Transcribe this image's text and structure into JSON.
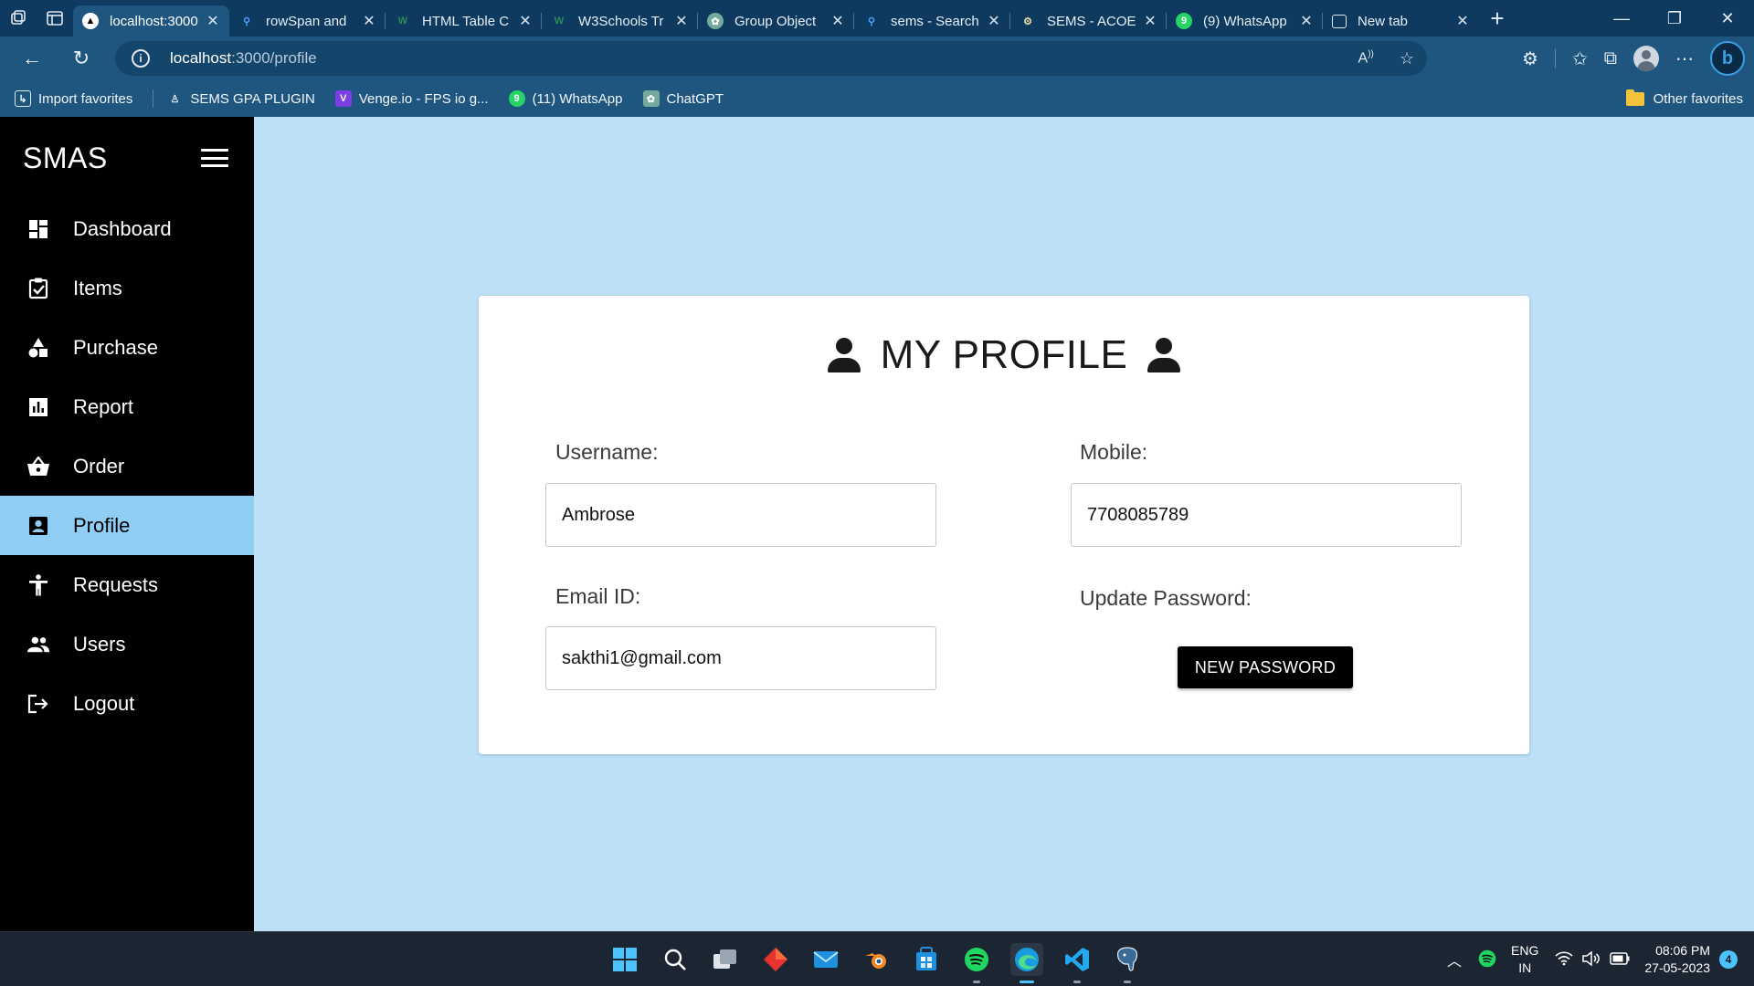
{
  "browser": {
    "tabs": [
      {
        "title": "localhost:3000",
        "icon": "react-triangle-icon",
        "active": true
      },
      {
        "title": "rowSpan and",
        "icon": "search-icon"
      },
      {
        "title": "HTML Table C",
        "icon": "w3schools-icon"
      },
      {
        "title": "W3Schools Tr",
        "icon": "w3schools-icon"
      },
      {
        "title": "Group Object",
        "icon": "chatgpt-icon"
      },
      {
        "title": "sems - Search",
        "icon": "search-icon"
      },
      {
        "title": "SEMS - ACOE",
        "icon": "sems-icon"
      },
      {
        "title": "(9) WhatsApp",
        "icon": "whatsapp-icon"
      },
      {
        "title": "New tab",
        "icon": "new-tab-icon"
      }
    ],
    "url_host": "localhost",
    "url_path": ":3000/profile",
    "favorites": [
      {
        "label": "Import favorites",
        "icon": "import-icon"
      },
      {
        "label": "SEMS GPA PLUGIN",
        "icon": "plugin-icon"
      },
      {
        "label": "Venge.io - FPS io g...",
        "icon": "venge-icon"
      },
      {
        "label": "(11) WhatsApp",
        "icon": "whatsapp-icon"
      },
      {
        "label": "ChatGPT",
        "icon": "chatgpt-icon"
      }
    ],
    "other_favorites": "Other favorites"
  },
  "sidebar": {
    "brand": "SMAS",
    "items": [
      {
        "label": "Dashboard",
        "icon": "dashboard-icon"
      },
      {
        "label": "Items",
        "icon": "clipboard-check-icon"
      },
      {
        "label": "Purchase",
        "icon": "shapes-icon"
      },
      {
        "label": "Report",
        "icon": "bar-chart-icon"
      },
      {
        "label": "Order",
        "icon": "basket-icon"
      },
      {
        "label": "Profile",
        "icon": "account-box-icon",
        "active": true
      },
      {
        "label": "Requests",
        "icon": "accessibility-icon"
      },
      {
        "label": "Users",
        "icon": "people-icon"
      },
      {
        "label": "Logout",
        "icon": "logout-icon"
      }
    ]
  },
  "profile": {
    "title": "MY PROFILE",
    "username_label": "Username:",
    "username_value": "Ambrose",
    "mobile_label": "Mobile:",
    "mobile_value": "7708085789",
    "email_label": "Email ID:",
    "email_value": "sakthi1@gmail.com",
    "password_label": "Update Password:",
    "password_button": "NEW PASSWORD"
  },
  "taskbar": {
    "lang_line1": "ENG",
    "lang_line2": "IN",
    "time": "08:06 PM",
    "date": "27-05-2023",
    "notification_count": "4"
  },
  "colors": {
    "page_background": "#bde0f6",
    "sidebar_active": "#8fcdf5",
    "browser_chrome": "#1f5680"
  }
}
